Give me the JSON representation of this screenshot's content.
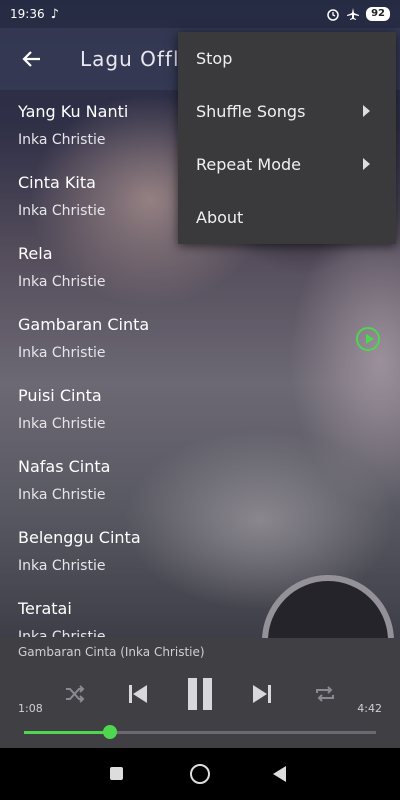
{
  "status_bar": {
    "time": "19:36",
    "music_icon": "music-note-icon",
    "icons": [
      "alarm-icon",
      "airplane-icon"
    ],
    "battery": "92"
  },
  "toolbar": {
    "back_icon": "arrow-left-icon",
    "title": "Lagu Offli"
  },
  "menu": {
    "items": [
      {
        "label": "Stop",
        "submenu": false
      },
      {
        "label": "Shuffle Songs",
        "submenu": true
      },
      {
        "label": "Repeat Mode",
        "submenu": true
      },
      {
        "label": "About",
        "submenu": false
      }
    ]
  },
  "songs": [
    {
      "title": "Yang Ku Nanti",
      "artist": "Inka Christie",
      "playing": false
    },
    {
      "title": "Cinta Kita",
      "artist": "Inka Christie",
      "playing": false
    },
    {
      "title": "Rela",
      "artist": "Inka Christie",
      "playing": false
    },
    {
      "title": "Gambaran Cinta",
      "artist": "Inka Christie",
      "playing": true
    },
    {
      "title": "Puisi Cinta",
      "artist": "Inka Christie",
      "playing": false
    },
    {
      "title": "Nafas Cinta",
      "artist": "Inka Christie",
      "playing": false
    },
    {
      "title": "Belenggu Cinta",
      "artist": "Inka Christie",
      "playing": false
    },
    {
      "title": "Teratai",
      "artist": "Inka Christie",
      "playing": false
    }
  ],
  "player": {
    "now_playing": "Gambaran Cinta (Inka Christie)",
    "elapsed": "1:08",
    "duration": "4:42",
    "progress": 0.245,
    "controls": [
      "shuffle-icon",
      "previous-icon",
      "pause-icon",
      "next-icon",
      "repeat-icon"
    ]
  },
  "colors": {
    "accent": "#4fd64f",
    "menu_bg": "#3a3a3c",
    "player_bg": "#3f3f44"
  }
}
